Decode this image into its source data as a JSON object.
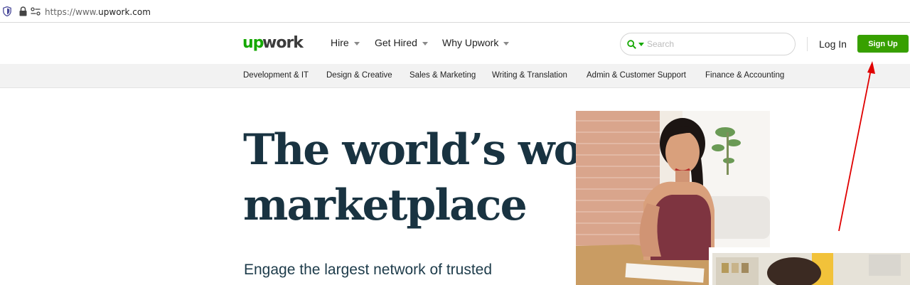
{
  "browser": {
    "url_prefix": "https://www.",
    "url_domain": "upwork.com",
    "icons": [
      "shield-icon",
      "lock-icon",
      "permissions-icon"
    ]
  },
  "header": {
    "logo_text": "upwork",
    "nav": [
      {
        "label": "Hire",
        "has_dropdown": true
      },
      {
        "label": "Get Hired",
        "has_dropdown": true
      },
      {
        "label": "Why Upwork",
        "has_dropdown": true
      }
    ],
    "search": {
      "placeholder": "Search",
      "value": "",
      "icon": "search-icon"
    },
    "login_label": "Log In",
    "signup_label": "Sign Up"
  },
  "categories": [
    "Development & IT",
    "Design & Creative",
    "Sales & Marketing",
    "Writing & Translation",
    "Admin & Customer Support",
    "Finance & Accounting"
  ],
  "hero": {
    "title_line1": "The world’s work",
    "title_line2": "marketplace",
    "subtitle": "Engage the largest network of trusted"
  },
  "colors": {
    "brand_green": "#14a800",
    "signup_green": "#37a000",
    "hero_text": "#193341",
    "annotation_red": "#e00000"
  }
}
